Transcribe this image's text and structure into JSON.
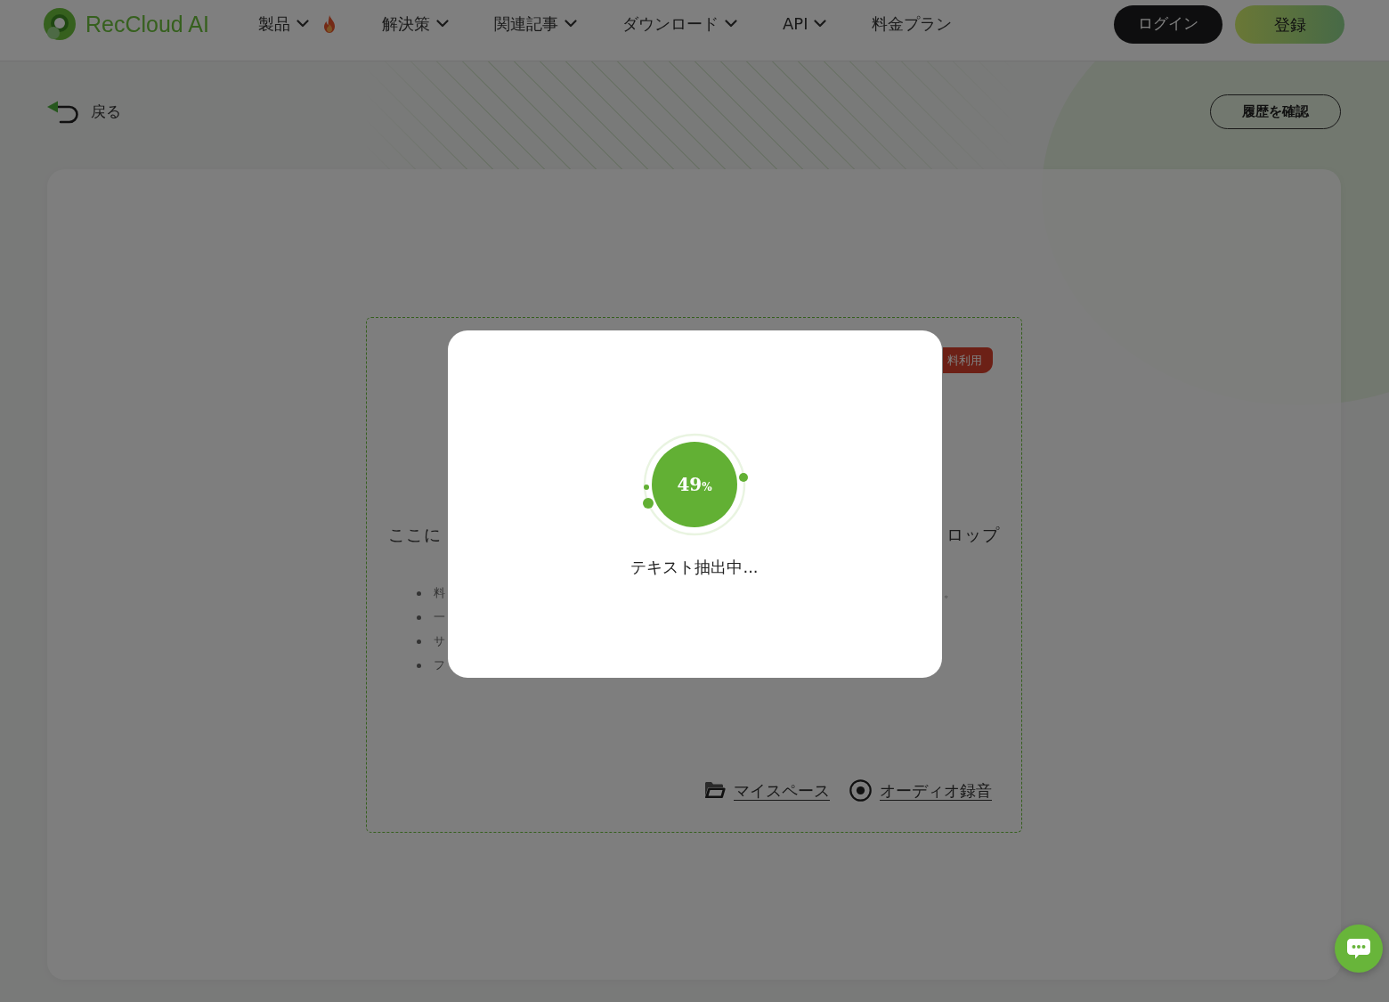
{
  "header": {
    "logo": "RecCloud AI",
    "nav": [
      {
        "label": "製品",
        "dropdown": true,
        "hot": true
      },
      {
        "label": "解決策",
        "dropdown": true,
        "hot": false
      },
      {
        "label": "関連記事",
        "dropdown": true,
        "hot": false
      },
      {
        "label": "ダウンロード",
        "dropdown": true,
        "hot": false
      },
      {
        "label": "API",
        "dropdown": true,
        "hot": false
      },
      {
        "label": "料金プラン",
        "dropdown": false,
        "hot": false
      }
    ],
    "buttons": [
      {
        "label": "ログイン",
        "kind": "dark"
      },
      {
        "label": "登録",
        "kind": "gradient"
      }
    ]
  },
  "toolbar": {
    "back": "戻る",
    "history_button": "履歴を確認"
  },
  "upload_area": {
    "badge": "料利用",
    "headline": {
      "start": "ここに",
      "end": "ロップ"
    },
    "bullets": [
      {
        "start": "料",
        "end": "。"
      },
      {
        "start": "一"
      },
      {
        "start": "サ"
      },
      {
        "start": "フ"
      }
    ],
    "links": [
      {
        "kind": "folder",
        "label": "マイスペース"
      },
      {
        "kind": "record",
        "label": "オーディオ録音"
      }
    ]
  },
  "progress_dialog": {
    "percent": "49",
    "unit": "%",
    "status": "テキスト抽出中..."
  }
}
